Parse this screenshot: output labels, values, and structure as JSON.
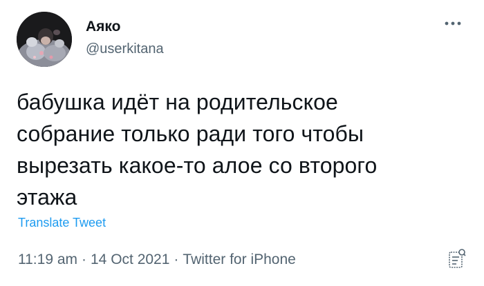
{
  "user": {
    "display_name": "Аяко",
    "handle": "@userkitana"
  },
  "tweet": {
    "text": "бабушка идёт на родительское\nсобрание только ради того чтобы\nвырезать какое-то алое со второго\nэтажа",
    "translate_label": "Translate Tweet",
    "time": "11:19 am",
    "date": "14 Oct 2021",
    "separator": "·",
    "source": "Twitter for iPhone"
  },
  "icons": {
    "more": "more-options-icon",
    "analytics": "analytics-icon"
  },
  "colors": {
    "text": "#0f1419",
    "secondary": "#536471",
    "link": "#1d9bf0"
  }
}
